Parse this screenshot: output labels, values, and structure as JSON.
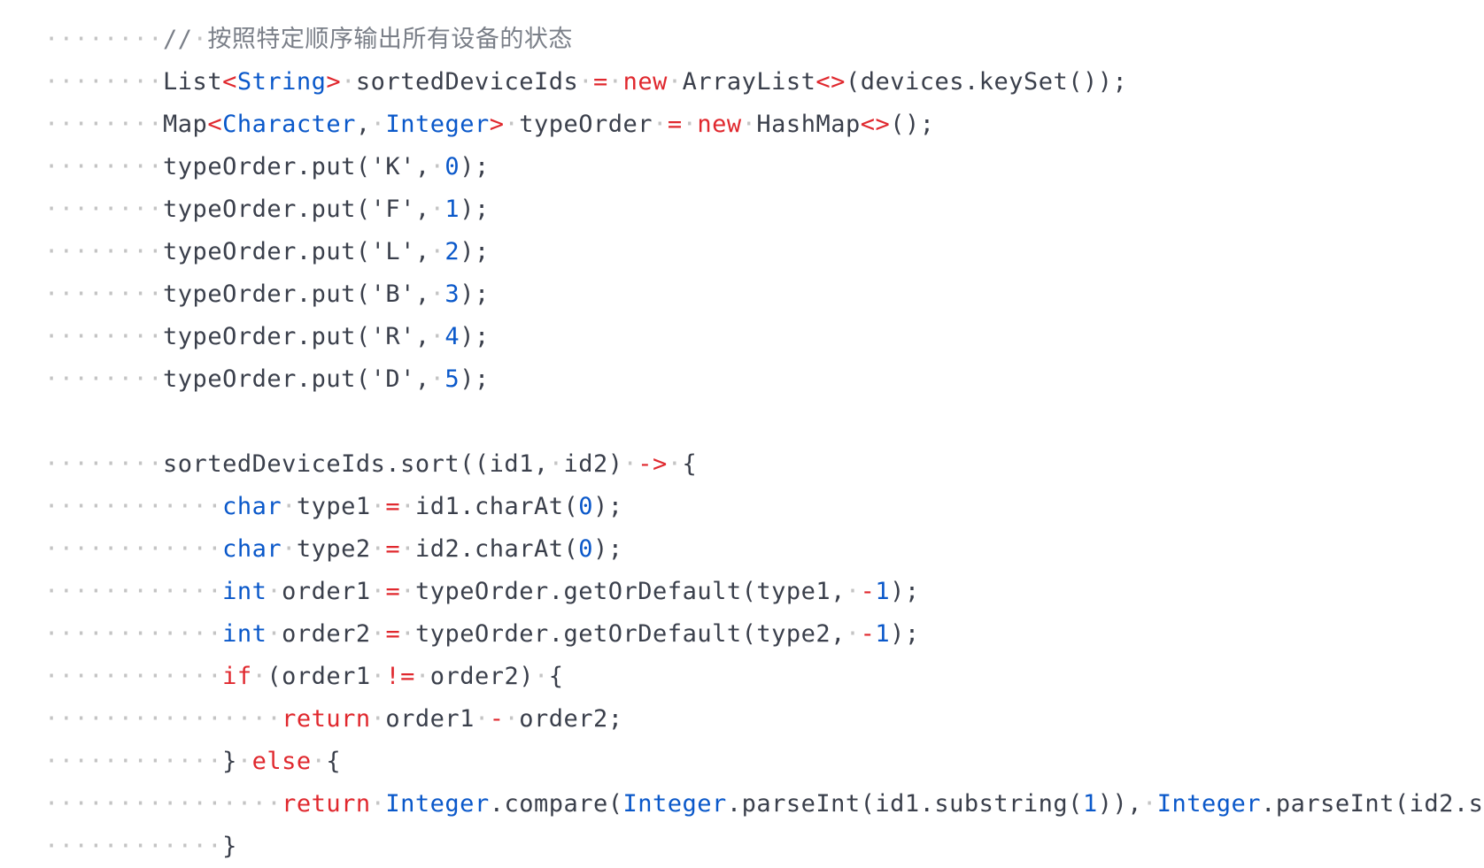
{
  "colors": {
    "plain": "#3a3f4b",
    "keyword": "#e0282e",
    "type": "#0a58ca",
    "number": "#0a58ca",
    "comment": "#7a7f88",
    "whitespace_dot": "#c4c4c4",
    "background": "#ffffff"
  },
  "lines": [
    [
      [
        "w",
        "········"
      ],
      [
        "c",
        "//"
      ],
      [
        "w",
        "·"
      ],
      [
        "c",
        "按照特定顺序输出所有设备的状态"
      ]
    ],
    [
      [
        "w",
        "········"
      ],
      [
        "p",
        "List"
      ],
      [
        "k",
        "<"
      ],
      [
        "t",
        "String"
      ],
      [
        "k",
        ">"
      ],
      [
        "w",
        "·"
      ],
      [
        "p",
        "sortedDeviceIds"
      ],
      [
        "w",
        "·"
      ],
      [
        "k",
        "="
      ],
      [
        "w",
        "·"
      ],
      [
        "k",
        "new"
      ],
      [
        "w",
        "·"
      ],
      [
        "p",
        "ArrayList"
      ],
      [
        "k",
        "<>"
      ],
      [
        "p",
        "(devices.keySet());"
      ]
    ],
    [
      [
        "w",
        "········"
      ],
      [
        "p",
        "Map"
      ],
      [
        "k",
        "<"
      ],
      [
        "t",
        "Character"
      ],
      [
        "p",
        ","
      ],
      [
        "w",
        "·"
      ],
      [
        "t",
        "Integer"
      ],
      [
        "k",
        ">"
      ],
      [
        "w",
        "·"
      ],
      [
        "p",
        "typeOrder"
      ],
      [
        "w",
        "·"
      ],
      [
        "k",
        "="
      ],
      [
        "w",
        "·"
      ],
      [
        "k",
        "new"
      ],
      [
        "w",
        "·"
      ],
      [
        "p",
        "HashMap"
      ],
      [
        "k",
        "<>"
      ],
      [
        "p",
        "();"
      ]
    ],
    [
      [
        "w",
        "········"
      ],
      [
        "p",
        "typeOrder.put('K',"
      ],
      [
        "w",
        "·"
      ],
      [
        "n",
        "0"
      ],
      [
        "p",
        ");"
      ]
    ],
    [
      [
        "w",
        "········"
      ],
      [
        "p",
        "typeOrder.put('F',"
      ],
      [
        "w",
        "·"
      ],
      [
        "n",
        "1"
      ],
      [
        "p",
        ");"
      ]
    ],
    [
      [
        "w",
        "········"
      ],
      [
        "p",
        "typeOrder.put('L',"
      ],
      [
        "w",
        "·"
      ],
      [
        "n",
        "2"
      ],
      [
        "p",
        ");"
      ]
    ],
    [
      [
        "w",
        "········"
      ],
      [
        "p",
        "typeOrder.put('B',"
      ],
      [
        "w",
        "·"
      ],
      [
        "n",
        "3"
      ],
      [
        "p",
        ");"
      ]
    ],
    [
      [
        "w",
        "········"
      ],
      [
        "p",
        "typeOrder.put('R',"
      ],
      [
        "w",
        "·"
      ],
      [
        "n",
        "4"
      ],
      [
        "p",
        ");"
      ]
    ],
    [
      [
        "w",
        "········"
      ],
      [
        "p",
        "typeOrder.put('D',"
      ],
      [
        "w",
        "·"
      ],
      [
        "n",
        "5"
      ],
      [
        "p",
        ");"
      ]
    ],
    [],
    [
      [
        "w",
        "········"
      ],
      [
        "p",
        "sortedDeviceIds.sort((id1,"
      ],
      [
        "w",
        "·"
      ],
      [
        "p",
        "id2)"
      ],
      [
        "w",
        "·"
      ],
      [
        "k",
        "->"
      ],
      [
        "w",
        "·"
      ],
      [
        "p",
        "{"
      ]
    ],
    [
      [
        "w",
        "············"
      ],
      [
        "t",
        "char"
      ],
      [
        "w",
        "·"
      ],
      [
        "p",
        "type1"
      ],
      [
        "w",
        "·"
      ],
      [
        "k",
        "="
      ],
      [
        "w",
        "·"
      ],
      [
        "p",
        "id1.charAt("
      ],
      [
        "n",
        "0"
      ],
      [
        "p",
        ");"
      ]
    ],
    [
      [
        "w",
        "············"
      ],
      [
        "t",
        "char"
      ],
      [
        "w",
        "·"
      ],
      [
        "p",
        "type2"
      ],
      [
        "w",
        "·"
      ],
      [
        "k",
        "="
      ],
      [
        "w",
        "·"
      ],
      [
        "p",
        "id2.charAt("
      ],
      [
        "n",
        "0"
      ],
      [
        "p",
        ");"
      ]
    ],
    [
      [
        "w",
        "············"
      ],
      [
        "t",
        "int"
      ],
      [
        "w",
        "·"
      ],
      [
        "p",
        "order1"
      ],
      [
        "w",
        "·"
      ],
      [
        "k",
        "="
      ],
      [
        "w",
        "·"
      ],
      [
        "p",
        "typeOrder.getOrDefault(type1,"
      ],
      [
        "w",
        "·"
      ],
      [
        "k",
        "-"
      ],
      [
        "n",
        "1"
      ],
      [
        "p",
        ");"
      ]
    ],
    [
      [
        "w",
        "············"
      ],
      [
        "t",
        "int"
      ],
      [
        "w",
        "·"
      ],
      [
        "p",
        "order2"
      ],
      [
        "w",
        "·"
      ],
      [
        "k",
        "="
      ],
      [
        "w",
        "·"
      ],
      [
        "p",
        "typeOrder.getOrDefault(type2,"
      ],
      [
        "w",
        "·"
      ],
      [
        "k",
        "-"
      ],
      [
        "n",
        "1"
      ],
      [
        "p",
        ");"
      ]
    ],
    [
      [
        "w",
        "············"
      ],
      [
        "k",
        "if"
      ],
      [
        "w",
        "·"
      ],
      [
        "p",
        "(order1"
      ],
      [
        "w",
        "·"
      ],
      [
        "k",
        "!="
      ],
      [
        "w",
        "·"
      ],
      [
        "p",
        "order2)"
      ],
      [
        "w",
        "·"
      ],
      [
        "p",
        "{"
      ]
    ],
    [
      [
        "w",
        "················"
      ],
      [
        "k",
        "return"
      ],
      [
        "w",
        "·"
      ],
      [
        "p",
        "order1"
      ],
      [
        "w",
        "·"
      ],
      [
        "k",
        "-"
      ],
      [
        "w",
        "·"
      ],
      [
        "p",
        "order2;"
      ]
    ],
    [
      [
        "w",
        "············"
      ],
      [
        "p",
        "}"
      ],
      [
        "w",
        "·"
      ],
      [
        "k",
        "else"
      ],
      [
        "w",
        "·"
      ],
      [
        "p",
        "{"
      ]
    ],
    [
      [
        "w",
        "················"
      ],
      [
        "k",
        "return"
      ],
      [
        "w",
        "·"
      ],
      [
        "t",
        "Integer"
      ],
      [
        "p",
        ".compare("
      ],
      [
        "t",
        "Integer"
      ],
      [
        "p",
        ".parseInt(id1.substring("
      ],
      [
        "n",
        "1"
      ],
      [
        "p",
        ")),"
      ],
      [
        "w",
        "·"
      ],
      [
        "t",
        "Integer"
      ],
      [
        "p",
        ".parseInt(id2.s"
      ]
    ],
    [
      [
        "w",
        "············"
      ],
      [
        "p",
        "}"
      ]
    ]
  ]
}
